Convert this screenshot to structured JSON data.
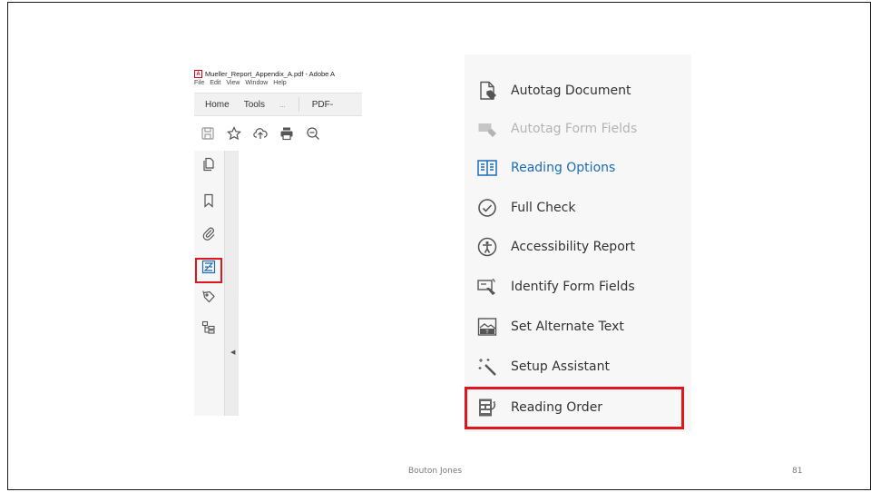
{
  "acrobat": {
    "window_title": "Mueller_Report_Appendix_A.pdf - Adobe A",
    "menu": [
      "File",
      "Edit",
      "View",
      "Window",
      "Help"
    ],
    "tabs": [
      "Home",
      "Tools",
      "...",
      "PDF-"
    ],
    "toolbar_icons": [
      "save-icon",
      "star-icon",
      "upload-icon",
      "print-icon",
      "zoom-out-icon"
    ],
    "rail_icons": [
      "page-thumbnails-icon",
      "bookmark-icon",
      "attachment-icon",
      "reading-order-icon",
      "tag-icon",
      "content-tree-icon"
    ],
    "highlight_color": "#e0161f"
  },
  "tools_panel": {
    "items": [
      {
        "label": "Autotag Document",
        "icon": "autotag-document-icon",
        "state": "normal"
      },
      {
        "label": "Autotag Form Fields",
        "icon": "autotag-form-fields-icon",
        "state": "disabled"
      },
      {
        "label": "Reading Options",
        "icon": "reading-options-icon",
        "state": "active"
      },
      {
        "label": "Full Check",
        "icon": "check-circle-icon",
        "state": "normal"
      },
      {
        "label": "Accessibility Report",
        "icon": "accessibility-icon",
        "state": "normal"
      },
      {
        "label": "Identify Form Fields",
        "icon": "identify-form-fields-icon",
        "state": "normal"
      },
      {
        "label": "Set Alternate Text",
        "icon": "alternate-text-icon",
        "state": "normal"
      },
      {
        "label": "Setup Assistant",
        "icon": "magic-wand-icon",
        "state": "normal"
      },
      {
        "label": "Reading Order",
        "icon": "reading-order-icon",
        "state": "highlighted"
      }
    ],
    "accent_color": "#1c6bb8",
    "highlight_color": "#e0161f"
  },
  "footer": {
    "author": "Bouton Jones",
    "page_number": "81"
  }
}
